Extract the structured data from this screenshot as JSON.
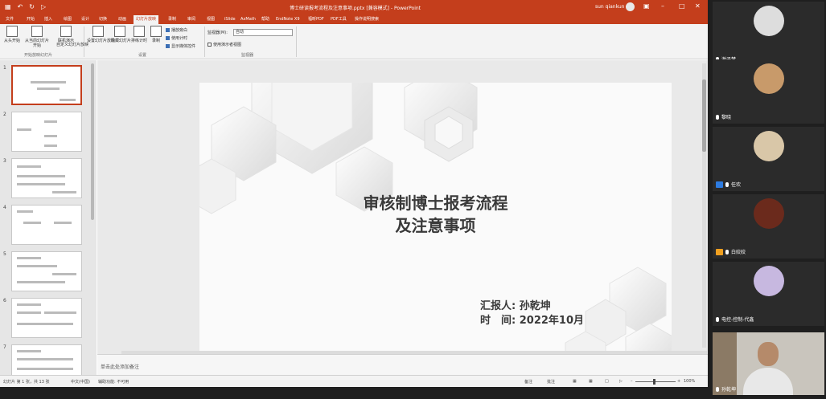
{
  "titlebar": {
    "doc_title": "博士研读报考流程及注意事项.pptx [兼容模式] - PowerPoint",
    "user": "sun qiankun"
  },
  "menu_tabs": [
    "文件",
    "开始",
    "插入",
    "绘图",
    "设计",
    "切换",
    "动画",
    "幻灯片放映",
    "录制",
    "审阅",
    "视图",
    "iSlide",
    "AxMath",
    "帮助",
    "EndNote X9",
    "福昕PDF",
    "PDF工具",
    "操作说明搜索"
  ],
  "active_tab_index": 7,
  "ribbon": {
    "start_show": {
      "from_beginning": "从头开始",
      "from_current": "从当前幻灯片开始",
      "online_present": "联机演示",
      "custom_show": "自定义幻灯片放映"
    },
    "setup": {
      "setup_show": "设置幻灯片放映",
      "hide_slide": "隐藏幻灯片",
      "rehearse": "排练计时",
      "record": "录制"
    },
    "checks": {
      "play_narration": "播放旁白",
      "use_timings": "使用计时",
      "show_media_controls": "显示媒体控件"
    },
    "monitor": {
      "monitor_label": "监视器(M):",
      "monitor_value": "自动",
      "presenter_view": "使用演示者视图"
    },
    "group_labels": {
      "start": "开始放映幻灯片",
      "setup": "设置",
      "monitors": "监视器"
    }
  },
  "thumbnails": [
    {
      "num": "1"
    },
    {
      "num": "2"
    },
    {
      "num": "3"
    },
    {
      "num": "4"
    },
    {
      "num": "5"
    },
    {
      "num": "6"
    },
    {
      "num": "7"
    }
  ],
  "slide": {
    "title_line1": "审核制博士报考流程",
    "title_line2": "及注意事项",
    "reporter": "汇报人: 孙乾坤",
    "date": "时　间: 2022年10月"
  },
  "notes_placeholder": "单击此处添加备注",
  "status": {
    "slide_count": "幻灯片 第 1 张，共 13 张",
    "language": "中文(中国)",
    "accessibility": "辅助功能: 不可用",
    "notes_btn": "备注",
    "comments_btn": "批注",
    "zoom": "100%"
  },
  "participants": [
    {
      "name": "谢子梦",
      "mic": true
    },
    {
      "name": "黎晓",
      "mic": true
    },
    {
      "name": "任欢",
      "mic": true,
      "sharing": "blue"
    },
    {
      "name": "白姣姣",
      "mic": true,
      "sharing": "orange"
    },
    {
      "name": "电控-控制-代鑫",
      "mic": true
    },
    {
      "name": "孙乾坤",
      "mic": true
    }
  ],
  "colors": {
    "ppt_accent": "#c43e1c",
    "panel_bg": "#1f1f1f"
  }
}
